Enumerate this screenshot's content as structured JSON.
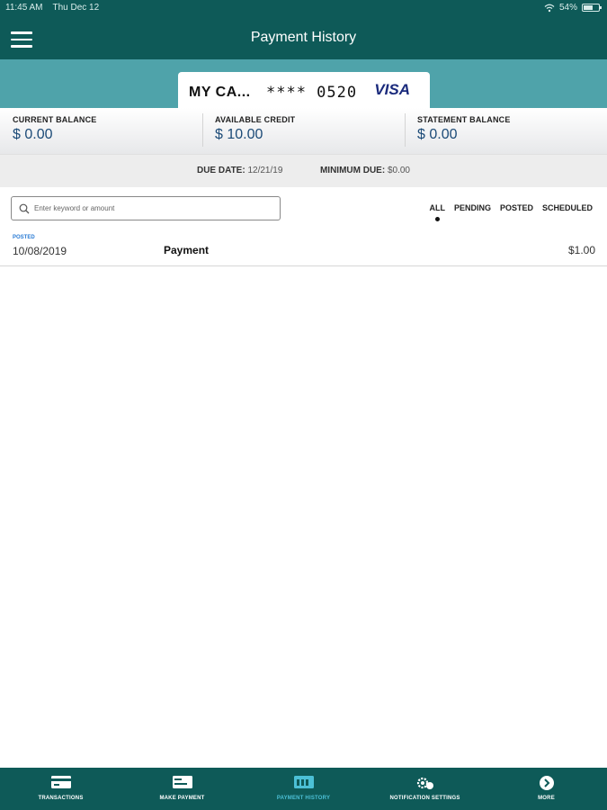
{
  "status_bar": {
    "time": "11:45 AM",
    "date": "Thu Dec 12",
    "battery": "54%"
  },
  "header": {
    "title": "Payment History"
  },
  "card": {
    "name": "MY CA...",
    "number": "**** 0520",
    "brand": "VISA"
  },
  "balances": [
    {
      "label": "CURRENT BALANCE",
      "value": "$ 0.00"
    },
    {
      "label": "AVAILABLE CREDIT",
      "value": "$ 10.00"
    },
    {
      "label": "STATEMENT BALANCE",
      "value": "$ 0.00"
    }
  ],
  "due": {
    "due_label": "DUE DATE:",
    "due_value": "12/21/19",
    "min_label": "MINIMUM DUE:",
    "min_value": "$0.00"
  },
  "search": {
    "placeholder": "Enter keyword or amount"
  },
  "filters": {
    "all": "ALL",
    "pending": "PENDING",
    "posted": "POSTED",
    "scheduled": "SCHEDULED",
    "active": "ALL"
  },
  "transactions": [
    {
      "status": "POSTED",
      "date": "10/08/2019",
      "description": "Payment",
      "amount": "$1.00"
    }
  ],
  "nav": {
    "transactions": "TRANSACTIONS",
    "make_payment": "MAKE PAYMENT",
    "payment_history": "PAYMENT HISTORY",
    "notification_settings": "NOTIFICATION SETTINGS",
    "more": "MORE",
    "active": "PAYMENT HISTORY"
  },
  "colors": {
    "header": "#0e5a58",
    "card_strip": "#4fa3aa",
    "accent": "#4cc0d6",
    "balance_value": "#1b4a77",
    "status_posted": "#2a7bd4"
  },
  "icons": [
    "menu-icon",
    "wifi-icon",
    "battery-icon",
    "search-icon",
    "card-icon",
    "payment-card-icon",
    "history-icon",
    "settings-gear-icon",
    "chevron-right-icon"
  ]
}
